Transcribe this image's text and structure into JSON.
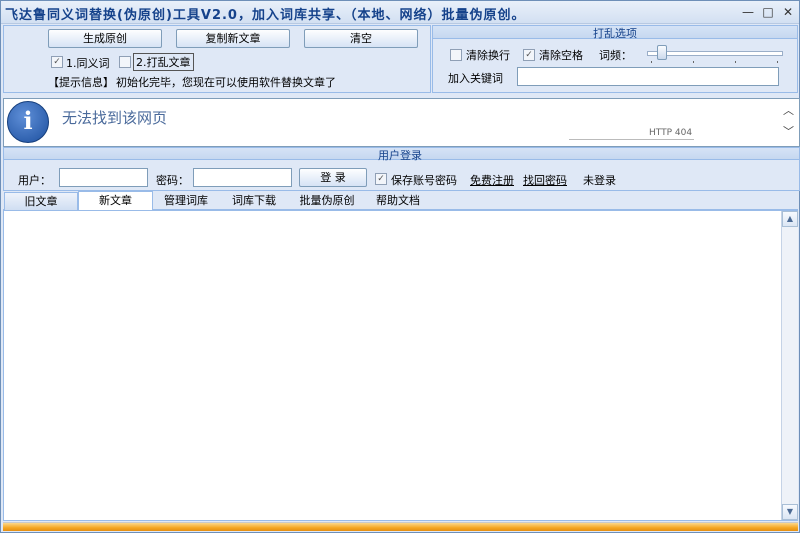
{
  "window": {
    "title": "飞达鲁同义词替换(伪原创)工具V2.0，加入词库共享、（本地、网络）批量伪原创。",
    "minimize_glyph": "—",
    "maximize_glyph": "□",
    "close_glyph": "✕"
  },
  "toolbar": {
    "generate_label": "生成原创",
    "copy_label": "复制新文章",
    "clear_label": "清空",
    "synonym_label": "1.同义词",
    "shuffle_label": "2.打乱文章",
    "hint_label": "【提示信息】",
    "hint_text": "初始化完毕，您现在可以使用软件替换文章了"
  },
  "shuffle_options": {
    "title": "打乱选项",
    "remove_newline_label": "清除换行",
    "remove_space_label": "清除空格",
    "frequency_label": "词频：",
    "frequency_value": 0.08,
    "keyword_label": "加入关键词",
    "keyword_value": ""
  },
  "browser": {
    "error_title": "无法找到该网页",
    "error_code": "HTTP 404",
    "info_glyph": "i",
    "scroll_up_glyph": "︿",
    "scroll_down_glyph": "﹀"
  },
  "login": {
    "title": "用户登录",
    "user_label": "用户：",
    "user_value": "",
    "password_label": "密码：",
    "password_value": "",
    "login_button": "登 录",
    "save_password_label": "保存账号密码",
    "register_link": "免费注册",
    "recover_link": "找回密码",
    "status": "未登录"
  },
  "tabs": [
    {
      "label": "旧文章"
    },
    {
      "label": "新文章"
    },
    {
      "label": "管理词库"
    },
    {
      "label": "词库下载"
    },
    {
      "label": "批量伪原创"
    },
    {
      "label": "帮助文档"
    }
  ],
  "editor": {
    "content": "",
    "scroll_up_glyph": "▲",
    "scroll_down_glyph": "▼"
  },
  "colors": {
    "title_text": "#15428b",
    "progress": "#f5a623"
  }
}
